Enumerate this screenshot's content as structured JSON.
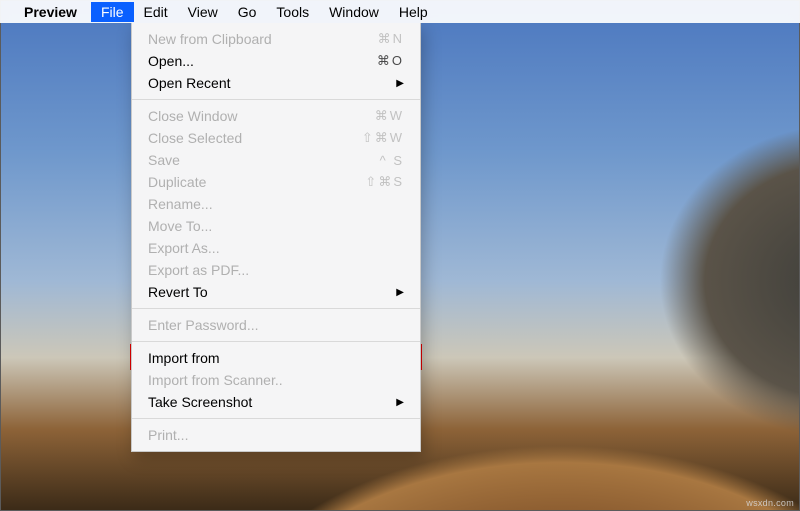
{
  "menubar": {
    "apple": "",
    "app_name": "Preview",
    "items": [
      "File",
      "Edit",
      "View",
      "Go",
      "Tools",
      "Window",
      "Help"
    ],
    "active_index": 0
  },
  "dropdown": {
    "groups": [
      [
        {
          "label": "New from Clipboard",
          "shortcut": "⌘N",
          "enabled": false
        },
        {
          "label": "Open...",
          "shortcut": "⌘O",
          "enabled": true
        },
        {
          "label": "Open Recent",
          "submenu": true,
          "enabled": true
        }
      ],
      [
        {
          "label": "Close Window",
          "shortcut": "⌘W",
          "enabled": false
        },
        {
          "label": "Close Selected",
          "shortcut": "⇧⌘W",
          "enabled": false
        },
        {
          "label": "Save",
          "shortcut": "^ S",
          "enabled": false
        },
        {
          "label": "Duplicate",
          "shortcut": "⇧⌘S",
          "enabled": false
        },
        {
          "label": "Rename...",
          "enabled": false
        },
        {
          "label": "Move To...",
          "enabled": false
        },
        {
          "label": "Export As...",
          "enabled": false
        },
        {
          "label": "Export as PDF...",
          "enabled": false
        },
        {
          "label": "Revert To",
          "submenu": true,
          "enabled": true
        }
      ],
      [
        {
          "label": "Enter Password...",
          "enabled": false
        }
      ],
      [
        {
          "label": "Import from",
          "enabled": true,
          "highlight": true
        },
        {
          "label": "Import from Scanner..",
          "enabled": false
        },
        {
          "label": "Take Screenshot",
          "submenu": true,
          "enabled": true
        }
      ],
      [
        {
          "label": "Print...",
          "enabled": false
        }
      ]
    ]
  },
  "watermark": "wsxdn.com"
}
